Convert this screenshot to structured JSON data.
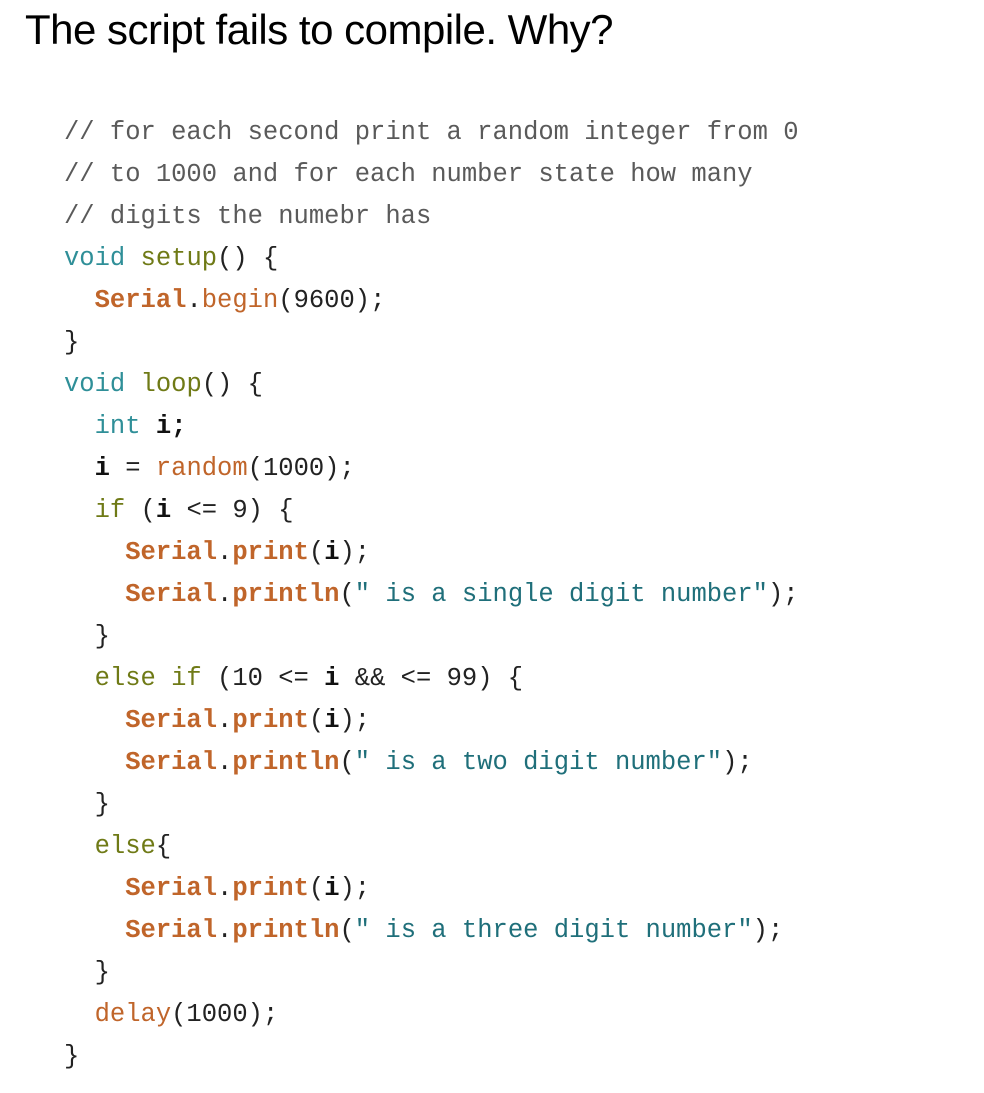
{
  "question": "The script fails to compile. Why?",
  "code_lines": [
    [
      {
        "t": "// for each second print a random integer from 0",
        "k": "comment"
      }
    ],
    [
      {
        "t": "// to 1000 and for each number state how many",
        "k": "comment"
      }
    ],
    [
      {
        "t": "// digits the numebr has",
        "k": "comment"
      }
    ],
    [
      {
        "t": "void",
        "k": "type"
      },
      {
        "t": " ",
        "k": "plain"
      },
      {
        "t": "setup",
        "k": "func"
      },
      {
        "t": "() {",
        "k": "plain"
      }
    ],
    [
      {
        "t": "  ",
        "k": "plain"
      },
      {
        "t": "Serial",
        "k": "lib"
      },
      {
        "t": ".",
        "k": "plain"
      },
      {
        "t": "begin",
        "k": "call"
      },
      {
        "t": "(9600);",
        "k": "plain"
      }
    ],
    [
      {
        "t": "}",
        "k": "plain"
      }
    ],
    [
      {
        "t": "void",
        "k": "type"
      },
      {
        "t": " ",
        "k": "plain"
      },
      {
        "t": "loop",
        "k": "func"
      },
      {
        "t": "() {",
        "k": "plain"
      }
    ],
    [
      {
        "t": "  ",
        "k": "plain"
      },
      {
        "t": "int",
        "k": "type"
      },
      {
        "t": " ",
        "k": "plain"
      },
      {
        "t": "i;",
        "k": "var"
      }
    ],
    [
      {
        "t": "  ",
        "k": "plain"
      },
      {
        "t": "i",
        "k": "var"
      },
      {
        "t": " = ",
        "k": "plain"
      },
      {
        "t": "random",
        "k": "call"
      },
      {
        "t": "(1000);",
        "k": "plain"
      }
    ],
    [
      {
        "t": "  ",
        "k": "plain"
      },
      {
        "t": "if",
        "k": "kw"
      },
      {
        "t": " (",
        "k": "plain"
      },
      {
        "t": "i",
        "k": "var"
      },
      {
        "t": " <= 9) {",
        "k": "plain"
      }
    ],
    [
      {
        "t": "    ",
        "k": "plain"
      },
      {
        "t": "Serial",
        "k": "lib"
      },
      {
        "t": ".",
        "k": "plain"
      },
      {
        "t": "print",
        "k": "lib"
      },
      {
        "t": "(",
        "k": "plain"
      },
      {
        "t": "i",
        "k": "var"
      },
      {
        "t": ");",
        "k": "plain"
      }
    ],
    [
      {
        "t": "    ",
        "k": "plain"
      },
      {
        "t": "Serial",
        "k": "lib"
      },
      {
        "t": ".",
        "k": "plain"
      },
      {
        "t": "println",
        "k": "lib"
      },
      {
        "t": "(",
        "k": "plain"
      },
      {
        "t": "\" is a single digit number\"",
        "k": "str"
      },
      {
        "t": ");",
        "k": "plain"
      }
    ],
    [
      {
        "t": "  }",
        "k": "plain"
      }
    ],
    [
      {
        "t": "  ",
        "k": "plain"
      },
      {
        "t": "else if",
        "k": "kw"
      },
      {
        "t": " (10 <= ",
        "k": "plain"
      },
      {
        "t": "i",
        "k": "var"
      },
      {
        "t": " && <= 99) {",
        "k": "plain"
      }
    ],
    [
      {
        "t": "    ",
        "k": "plain"
      },
      {
        "t": "Serial",
        "k": "lib"
      },
      {
        "t": ".",
        "k": "plain"
      },
      {
        "t": "print",
        "k": "lib"
      },
      {
        "t": "(",
        "k": "plain"
      },
      {
        "t": "i",
        "k": "var"
      },
      {
        "t": ");",
        "k": "plain"
      }
    ],
    [
      {
        "t": "    ",
        "k": "plain"
      },
      {
        "t": "Serial",
        "k": "lib"
      },
      {
        "t": ".",
        "k": "plain"
      },
      {
        "t": "println",
        "k": "lib"
      },
      {
        "t": "(",
        "k": "plain"
      },
      {
        "t": "\" is a two digit number\"",
        "k": "str"
      },
      {
        "t": ");",
        "k": "plain"
      }
    ],
    [
      {
        "t": "  }",
        "k": "plain"
      }
    ],
    [
      {
        "t": "  ",
        "k": "plain"
      },
      {
        "t": "else",
        "k": "kw"
      },
      {
        "t": "{",
        "k": "plain"
      }
    ],
    [
      {
        "t": "    ",
        "k": "plain"
      },
      {
        "t": "Serial",
        "k": "lib"
      },
      {
        "t": ".",
        "k": "plain"
      },
      {
        "t": "print",
        "k": "lib"
      },
      {
        "t": "(",
        "k": "plain"
      },
      {
        "t": "i",
        "k": "var"
      },
      {
        "t": ");",
        "k": "plain"
      }
    ],
    [
      {
        "t": "    ",
        "k": "plain"
      },
      {
        "t": "Serial",
        "k": "lib"
      },
      {
        "t": ".",
        "k": "plain"
      },
      {
        "t": "println",
        "k": "lib"
      },
      {
        "t": "(",
        "k": "plain"
      },
      {
        "t": "\" is a three digit number\"",
        "k": "str"
      },
      {
        "t": ");",
        "k": "plain"
      }
    ],
    [
      {
        "t": "  }",
        "k": "plain"
      }
    ],
    [
      {
        "t": "  ",
        "k": "plain"
      },
      {
        "t": "delay",
        "k": "call"
      },
      {
        "t": "(1000);",
        "k": "plain"
      }
    ],
    [
      {
        "t": "}",
        "k": "plain"
      }
    ]
  ]
}
